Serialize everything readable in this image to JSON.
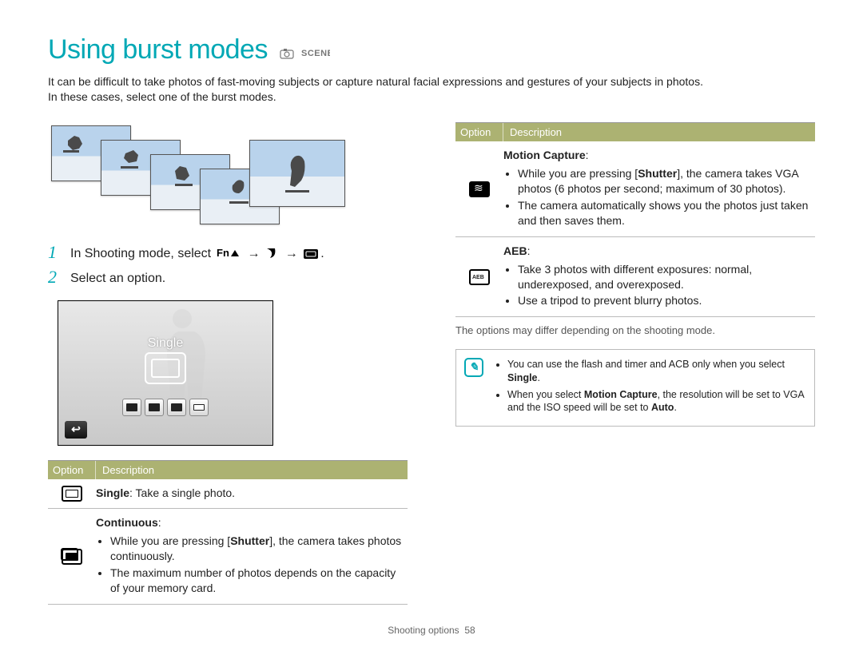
{
  "title": "Using burst modes",
  "title_suffix_modes": "SCENE",
  "intro_line1": "It can be difficult to take photos of fast-moving subjects or capture natural facial expressions and gestures of your subjects in photos.",
  "intro_line2": "In these cases, select one of the burst modes.",
  "steps": [
    {
      "num": "1",
      "prefix": "In Shooting mode, select ",
      "suffix": "."
    },
    {
      "num": "2",
      "text": "Select an option."
    }
  ],
  "preview_label": "Single",
  "table_headers": {
    "option": "Option",
    "description": "Description"
  },
  "left_options": [
    {
      "icon": "single",
      "title": "Single",
      "title_suffix": ": Take a single photo."
    },
    {
      "icon": "cont",
      "title": "Continuous",
      "title_suffix": ":",
      "bullets": [
        "While you are pressing [<b>Shutter</b>], the camera takes photos continuously.",
        "The maximum number of photos depends on the capacity of your memory card."
      ]
    }
  ],
  "right_options": [
    {
      "icon": "motion",
      "title": "Motion Capture",
      "title_suffix": ":",
      "bullets": [
        "While you are pressing [<b>Shutter</b>], the camera takes VGA photos (6 photos per second; maximum of 30 photos).",
        "The camera automatically shows you the photos just taken and then saves them."
      ]
    },
    {
      "icon": "aeb",
      "title": "AEB",
      "title_suffix": ":",
      "bullets": [
        "Take 3 photos with different exposures: normal, underexposed, and overexposed.",
        "Use a tripod to prevent blurry photos."
      ]
    }
  ],
  "options_note": "The options may differ depending on the shooting mode.",
  "info_bullets": [
    "You can use the flash and timer and ACB only when you select <b>Single</b>.",
    "When you select <b>Motion Capture</b>, the resolution will be set to VGA and the ISO speed will be set to <b>Auto</b>."
  ],
  "footer_section": "Shooting options",
  "footer_page": "58"
}
